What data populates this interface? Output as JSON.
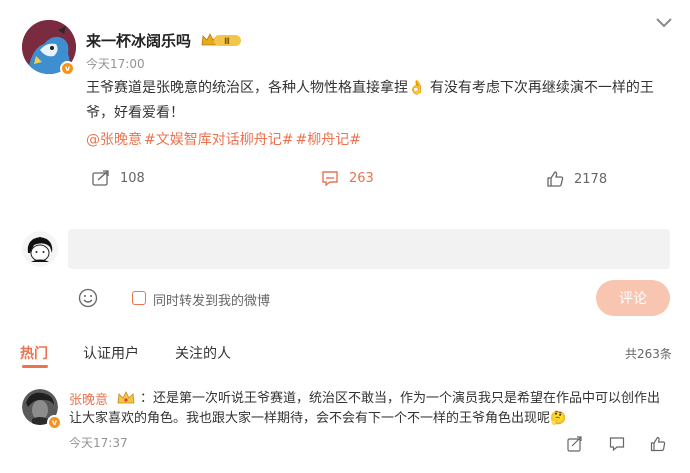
{
  "post": {
    "author": "来一杯冰阔乐吗",
    "rank_badge": "Ⅱ",
    "time": "今天17:00",
    "content": "王爷赛道是张晚意的统治区，各种人物性格直接拿捏👌 有没有考虑下次再继续演不一样的王爷，好看爱看！",
    "tags": [
      "@张晚意",
      "#文娱智库对话柳舟记#",
      "#柳舟记#"
    ],
    "reposts": "108",
    "comments": "263",
    "likes": "2178",
    "verified_icon": "v-badge-icon"
  },
  "composer": {
    "placeholder": "",
    "repost_label": "同时转发到我的微博",
    "submit_label": "评论"
  },
  "tabs": [
    {
      "label": "热门"
    },
    {
      "label": "认证用户"
    },
    {
      "label": "关注的人"
    }
  ],
  "comment_count": "共263条",
  "comment": {
    "author": "张晚意",
    "separator": "：",
    "text_line1": "还是第一次听说王爷赛道，统治区不敢当，作为一个演员我只是希望在作品中可以创作出",
    "text_line2": "让大家喜欢的角色。我也跟大家一样期待，会不会有下一个不一样的王爷角色出现呢🤔",
    "time": "今天17:37"
  },
  "colors": {
    "accent": "#eb7350",
    "muted": "#939393",
    "submit_bg": "#f8c5b0"
  }
}
